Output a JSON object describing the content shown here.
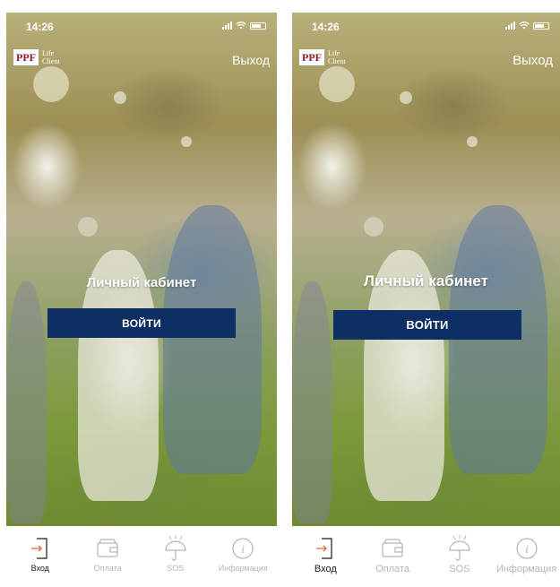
{
  "screens": [
    {
      "status": {
        "time": "14:26"
      },
      "logo": {
        "brand": "PPF",
        "line1": "Life",
        "line2": "Client"
      },
      "header": {
        "logout_label": "Выход"
      },
      "main": {
        "title": "Личный кабинет",
        "login_label": "ВОЙТИ"
      },
      "tabs": [
        {
          "label": "Вход",
          "icon": "login-icon",
          "active": true
        },
        {
          "label": "Оплата",
          "icon": "wallet-icon",
          "active": false
        },
        {
          "label": "SOS",
          "icon": "umbrella-icon",
          "active": false
        },
        {
          "label": "Информация",
          "icon": "info-icon",
          "active": false
        }
      ]
    },
    {
      "status": {
        "time": "14:26"
      },
      "logo": {
        "brand": "PPF",
        "line1": "Life",
        "line2": "Client"
      },
      "header": {
        "logout_label": "Выход"
      },
      "main": {
        "title": "Личный кабинет",
        "login_label": "ВОЙТИ"
      },
      "tabs": [
        {
          "label": "Вход",
          "icon": "login-icon",
          "active": true
        },
        {
          "label": "Оплата",
          "icon": "wallet-icon",
          "active": false
        },
        {
          "label": "SOS",
          "icon": "umbrella-icon",
          "active": false
        },
        {
          "label": "Информация",
          "icon": "info-icon",
          "active": false
        }
      ]
    }
  ],
  "colors": {
    "accent": "#e8643c",
    "button": "#0e2f63",
    "tab_inactive": "#b4b4b4",
    "logo_red": "#8a1c2b"
  }
}
